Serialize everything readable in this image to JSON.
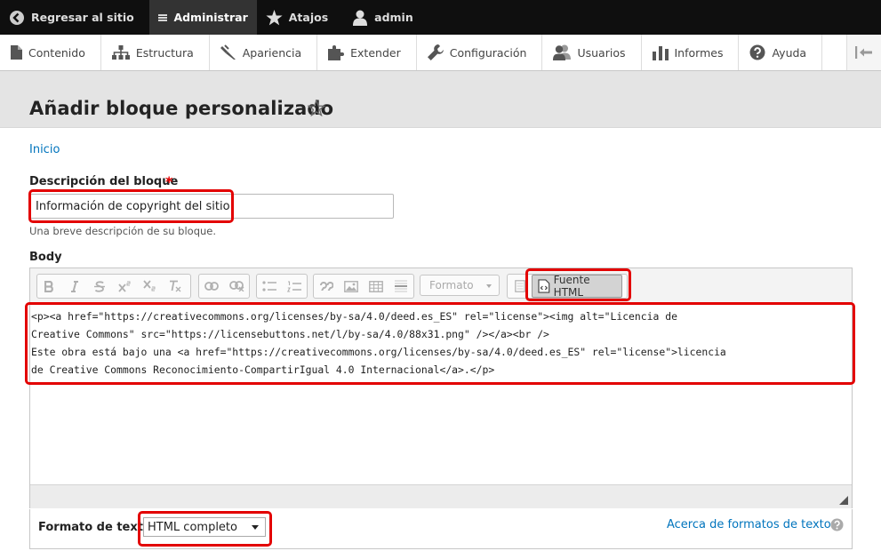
{
  "toolbar": {
    "back_label": "Regresar al sitio",
    "manage_label": "Administrar",
    "shortcuts_label": "Atajos",
    "user_label": "admin"
  },
  "tray": {
    "items": [
      {
        "label": "Contenido",
        "icon": "file-icon"
      },
      {
        "label": "Estructura",
        "icon": "sitemap-icon"
      },
      {
        "label": "Apariencia",
        "icon": "paintbrush-icon"
      },
      {
        "label": "Extender",
        "icon": "puzzle-icon"
      },
      {
        "label": "Configuración",
        "icon": "wrench-icon"
      },
      {
        "label": "Usuarios",
        "icon": "users-icon"
      },
      {
        "label": "Informes",
        "icon": "bar-chart-icon"
      },
      {
        "label": "Ayuda",
        "icon": "help-icon"
      }
    ]
  },
  "page": {
    "title": "Añadir bloque personalizado",
    "breadcrumb": "Inicio"
  },
  "form": {
    "description_label": "Descripción del bloque",
    "required_mark": "*",
    "description_value": "Información de copyright del sitio",
    "description_help": "Una breve descripción de su bloque.",
    "body_label": "Body",
    "editor": {
      "format_placeholder": "Formato",
      "source_button": "Fuente HTML",
      "source_lines": [
        "<p><a href=\"https://creativecommons.org/licenses/by-sa/4.0/deed.es_ES\" rel=\"license\"><img alt=\"Licencia de",
        "Creative Commons\" src=\"https://licensebuttons.net/l/by-sa/4.0/88x31.png\" /></a><br />",
        "Este obra está bajo una <a href=\"https://creativecommons.org/licenses/by-sa/4.0/deed.es_ES\" rel=\"license\">licencia",
        "de Creative Commons Reconocimiento-CompartirIgual 4.0 Internacional</a>.</p>"
      ]
    },
    "text_format_label": "Formato de texto",
    "text_format_value": "HTML completo",
    "text_format_help": "Acerca de formatos de texto"
  },
  "colors": {
    "highlight": "#e30000",
    "link": "#0074bd",
    "toolbar_bg": "#0f0f0f"
  }
}
